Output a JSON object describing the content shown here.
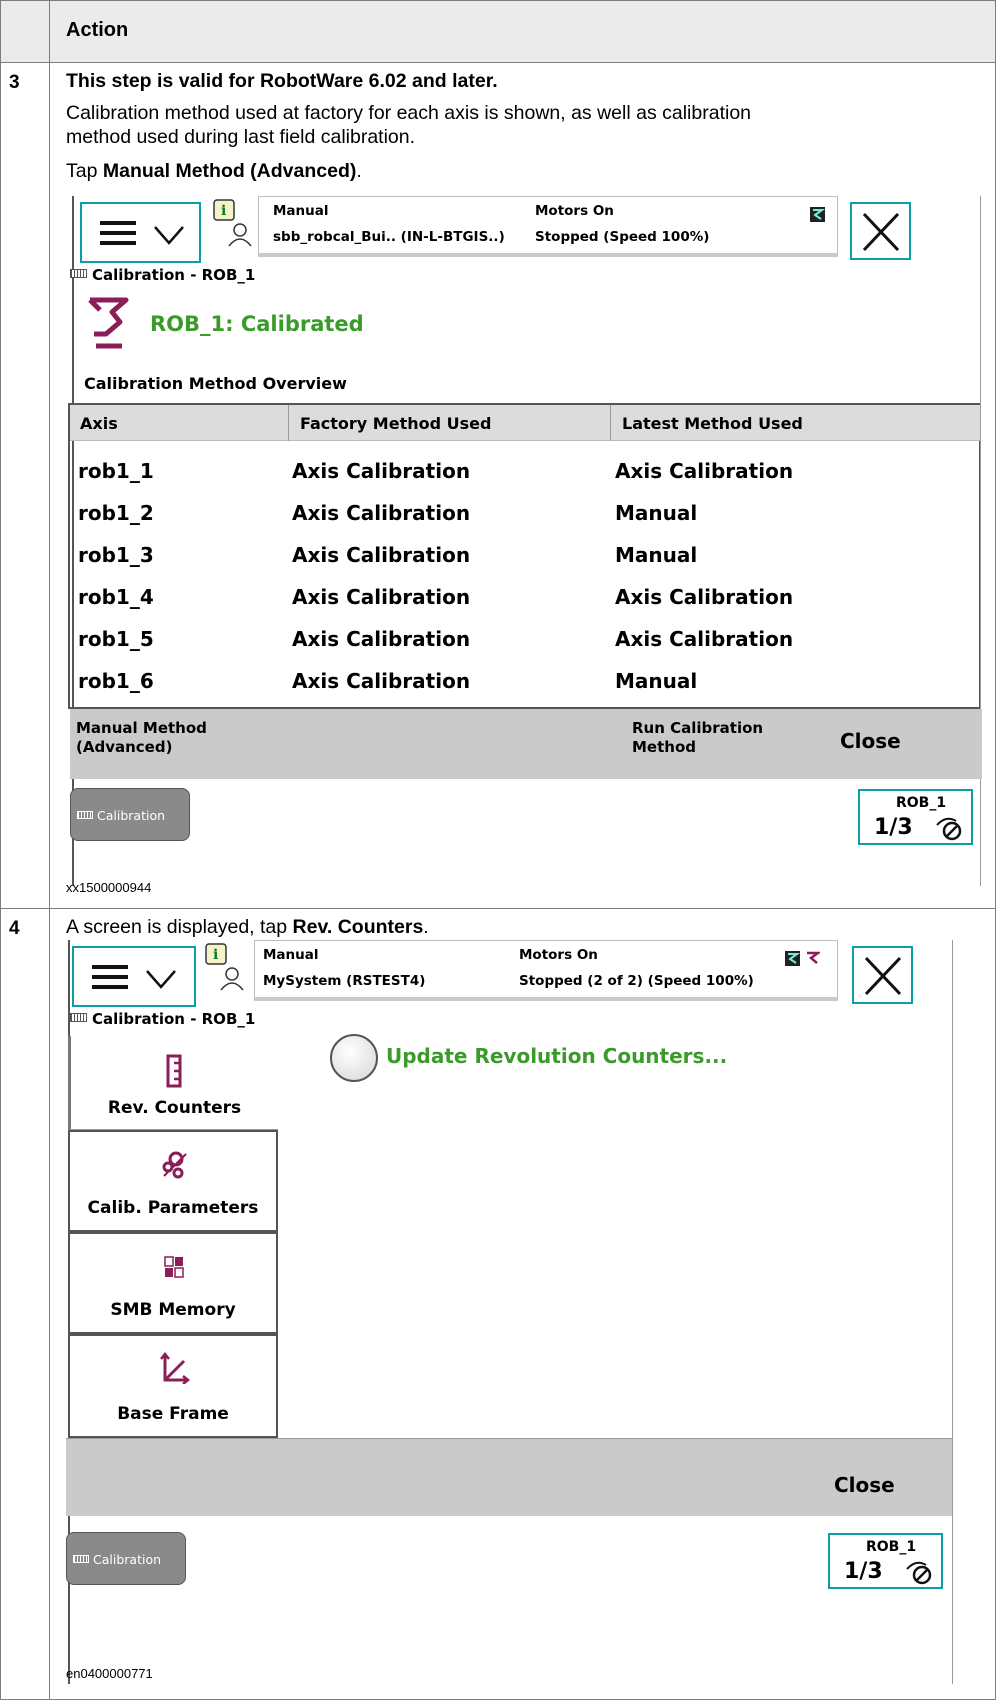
{
  "header": {
    "action_label": "Action"
  },
  "steps": [
    {
      "number": "3",
      "line1": "This step is valid for RobotWare 6.02 and later.",
      "line2": "Calibration method used at factory for each axis is shown, as well as calibration",
      "line3": "method used during last field calibration.",
      "tap_prefix": "Tap ",
      "tap_bold": "Manual Method (Advanced)",
      "tap_suffix": ".",
      "caption": "xx1500000944",
      "screen": {
        "status_mode": "Manual",
        "status_system": "sbb_robcal_Bui.. (IN-L-BTGIS..)",
        "status_motors": "Motors On",
        "status_state": "Stopped (Speed 100%)",
        "window_title": "Calibration - ROB_1",
        "calib_status": "ROB_1:  Calibrated",
        "overview_title": "Calibration Method Overview",
        "columns": [
          "Axis",
          "Factory Method Used",
          "Latest Method Used"
        ],
        "rows": [
          [
            "rob1_1",
            "Axis Calibration",
            "Axis Calibration"
          ],
          [
            "rob1_2",
            "Axis Calibration",
            "Manual"
          ],
          [
            "rob1_3",
            "Axis Calibration",
            "Manual"
          ],
          [
            "rob1_4",
            "Axis Calibration",
            "Axis Calibration"
          ],
          [
            "rob1_5",
            "Axis Calibration",
            "Axis Calibration"
          ],
          [
            "rob1_6",
            "Axis Calibration",
            "Manual"
          ]
        ],
        "cmd_manual_1": "Manual Method",
        "cmd_manual_2": "(Advanced)",
        "cmd_run_1": "Run Calibration",
        "cmd_run_2": "Method",
        "cmd_close": "Close",
        "taskbar_label": "Calibration",
        "quickset_rob": "ROB_1",
        "quickset_frac": "1/3"
      }
    },
    {
      "number": "4",
      "line1_prefix": "A screen is displayed, tap ",
      "line1_bold": "Rev. Counters",
      "line1_suffix": ".",
      "caption": "en0400000771",
      "screen": {
        "status_mode": "Manual",
        "status_system": "MySystem (RSTEST4)",
        "status_motors": "Motors On",
        "status_state": "Stopped (2 of 2) (Speed 100%)",
        "window_title": "Calibration - ROB_1",
        "side_buttons": [
          "Rev. Counters",
          "Calib. Parameters",
          "SMB Memory",
          "Base Frame"
        ],
        "option_label": "Update Revolution Counters...",
        "cmd_close": "Close",
        "taskbar_label": "Calibration",
        "quickset_rob": "ROB_1",
        "quickset_frac": "1/3"
      }
    }
  ],
  "colors": {
    "accent_teal": "#0a9ea7",
    "robot_icon": "#8a1e58",
    "status_green": "#3a9a2a",
    "header_bg": "#ebebeb"
  }
}
